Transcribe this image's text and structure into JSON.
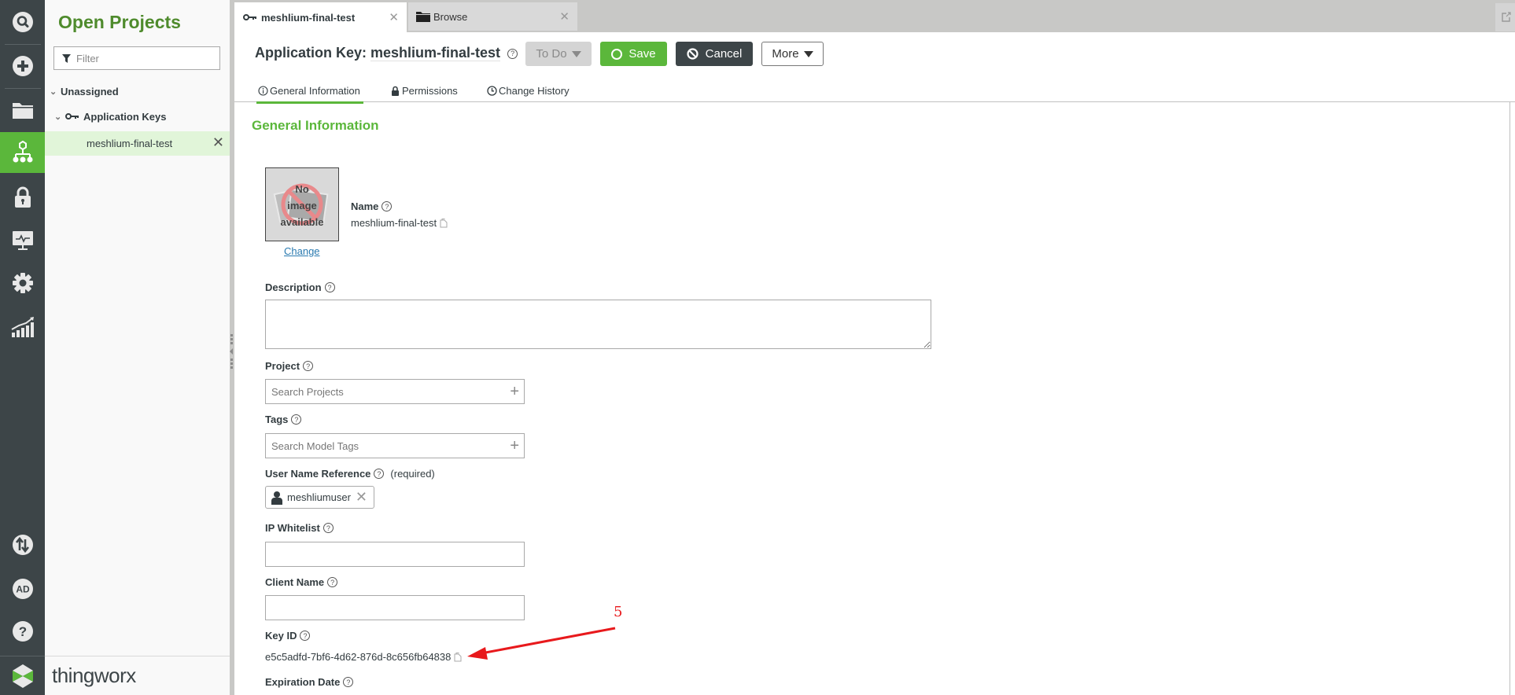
{
  "rail": {
    "items": [
      {
        "name": "search",
        "label": "Search"
      },
      {
        "name": "new",
        "label": "New"
      },
      {
        "name": "browse",
        "label": "Browse"
      },
      {
        "name": "projects",
        "label": "Projects",
        "active": true
      },
      {
        "name": "security",
        "label": "Security"
      },
      {
        "name": "monitoring",
        "label": "Monitoring"
      },
      {
        "name": "settings",
        "label": "Settings"
      },
      {
        "name": "analytics",
        "label": "Analytics"
      },
      {
        "name": "import-export",
        "label": "Import/Export"
      },
      {
        "name": "user",
        "label": "AD"
      },
      {
        "name": "help",
        "label": "Help"
      }
    ],
    "avatar_initials": "AD"
  },
  "projects_panel": {
    "title": "Open Projects",
    "filter_placeholder": "Filter",
    "tree": {
      "group": "Unassigned",
      "category": "Application Keys",
      "selected_item": "meshlium-final-test"
    },
    "brand": "thingworx"
  },
  "tabs": [
    {
      "label": "meshlium-final-test",
      "icon": "key-icon",
      "active": true
    },
    {
      "label": "Browse",
      "icon": "folder-icon",
      "active": false
    }
  ],
  "header": {
    "title_prefix": "Application Key:",
    "title_name": "meshlium-final-test",
    "status_label": "To Do",
    "save_label": "Save",
    "cancel_label": "Cancel",
    "more_label": "More"
  },
  "subtabs": [
    {
      "label": "General Information",
      "icon": "info-icon",
      "active": true
    },
    {
      "label": "Permissions",
      "icon": "lock-icon",
      "active": false
    },
    {
      "label": "Change History",
      "icon": "clock-icon",
      "active": false
    }
  ],
  "section_title": "General Information",
  "form": {
    "image": {
      "placeholder_lines": [
        "No",
        "image",
        "available"
      ],
      "change_label": "Change"
    },
    "name": {
      "label": "Name",
      "value": "meshlium-final-test"
    },
    "description": {
      "label": "Description",
      "value": ""
    },
    "project": {
      "label": "Project",
      "placeholder": "Search Projects",
      "value": ""
    },
    "tags": {
      "label": "Tags",
      "placeholder": "Search Model Tags",
      "value": ""
    },
    "user_name_reference": {
      "label": "User Name Reference",
      "note": "(required)",
      "value": "meshliumuser"
    },
    "ip_whitelist": {
      "label": "IP Whitelist",
      "value": ""
    },
    "client_name": {
      "label": "Client Name",
      "value": ""
    },
    "key_id": {
      "label": "Key ID",
      "value": "e5c5adfd-7bf6-4d62-876d-8c656fb64838"
    },
    "expiration_date": {
      "label": "Expiration Date"
    }
  },
  "annotation": {
    "number": "5",
    "color": "#e8191c"
  },
  "colors": {
    "accent_green": "#5bb73b",
    "rail_dark": "#3d4548",
    "title_green": "#4f8b2d"
  }
}
